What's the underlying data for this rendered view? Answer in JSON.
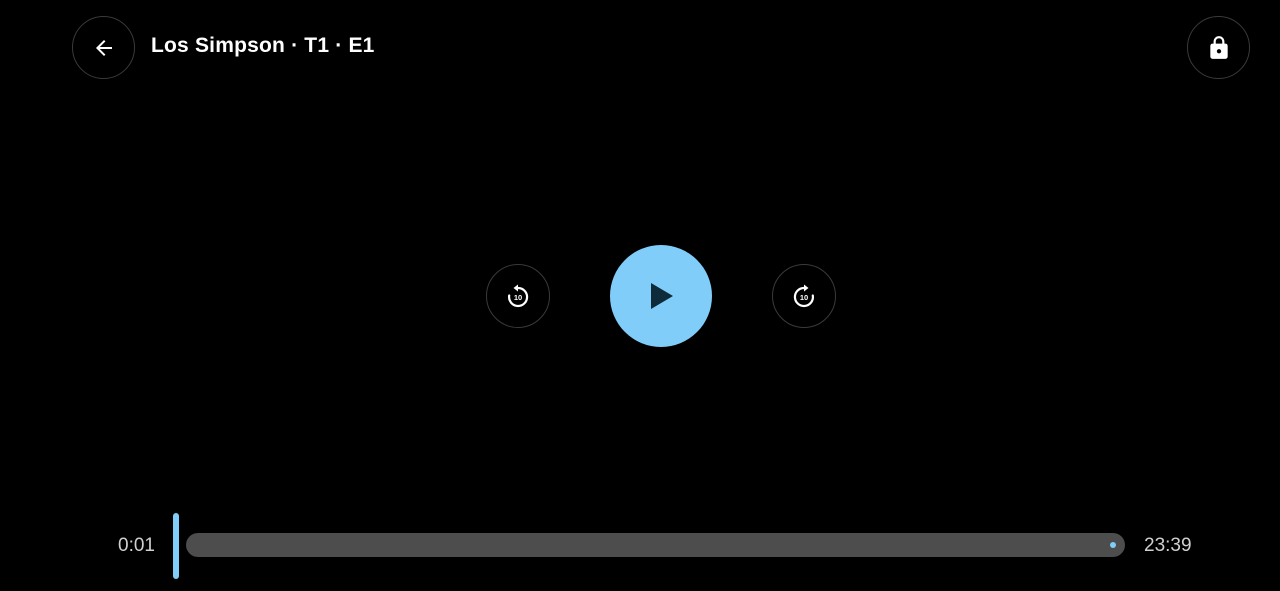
{
  "header": {
    "title": "Los Simpson · T1 · E1",
    "back_icon": "arrow-left-icon",
    "lock_icon": "lock-icon"
  },
  "controls": {
    "rewind_icon": "replay-10-icon",
    "rewind_seconds": "10",
    "play_icon": "play-icon",
    "forward_icon": "forward-10-icon",
    "forward_seconds": "10"
  },
  "progress": {
    "elapsed": "0:01",
    "total": "23:39",
    "fraction_played": 0.0007
  },
  "colors": {
    "accent": "#7fcdf8",
    "background": "#000000",
    "track": "#4d4d4d",
    "play_icon": "#0d2b3a"
  }
}
